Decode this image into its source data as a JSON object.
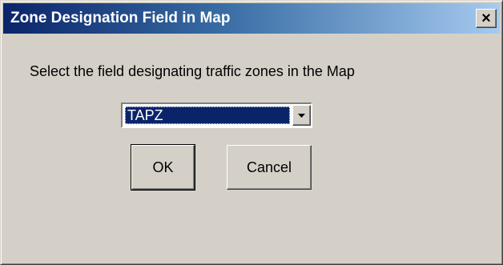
{
  "dialog": {
    "title": "Zone Designation Field in Map",
    "close_glyph": "×",
    "prompt": "Select the field designating traffic zones in the Map",
    "field_select": {
      "selected_value": "TAPZ"
    },
    "buttons": {
      "ok_label": "OK",
      "cancel_label": "Cancel"
    }
  },
  "colors": {
    "face": "#d4d0c8",
    "title_start": "#0a246a",
    "title_end": "#a6caf0",
    "selection": "#0a246a"
  },
  "icons": {
    "close": "close-icon",
    "dropdown": "chevron-down-icon"
  }
}
